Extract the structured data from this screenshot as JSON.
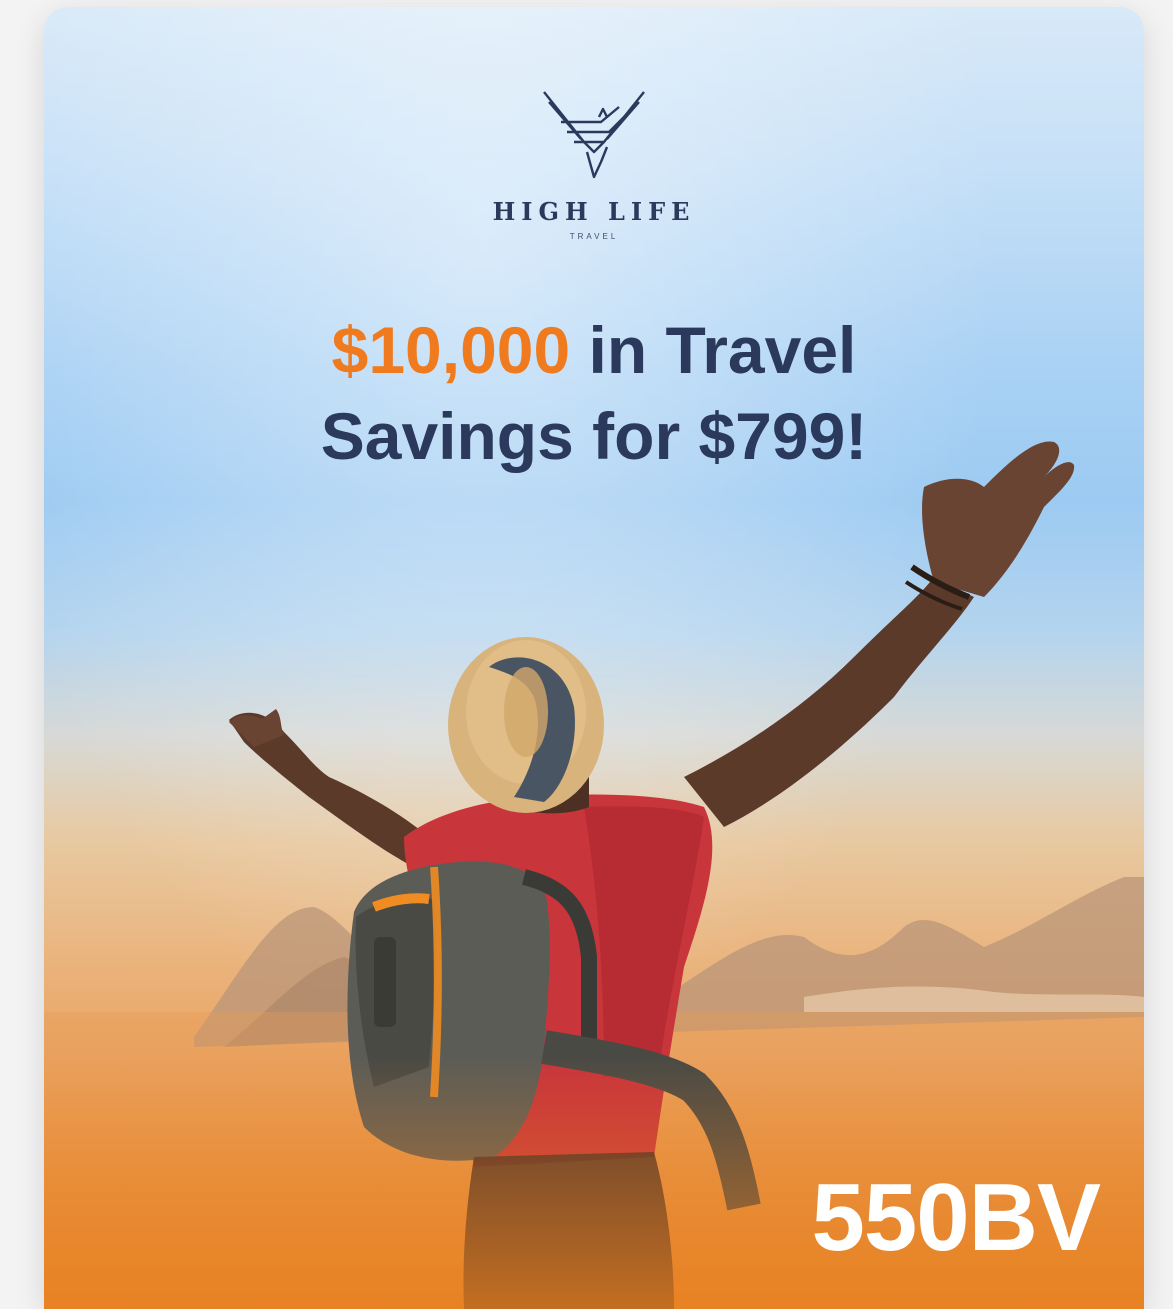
{
  "brand": {
    "name": "HIGH LIFE",
    "sub": "TRAVEL",
    "logo_icon": "eagle-wing-icon"
  },
  "headline": {
    "accent": "$10,000",
    "line1_rest": " in Travel",
    "line2": "Savings for $799!"
  },
  "badge": {
    "bv": "550BV"
  },
  "colors": {
    "navy": "#2b3a5c",
    "accent_orange": "#f07a1e",
    "sky_top": "#d8e9f8",
    "bottom_orange": "#e8801f"
  }
}
